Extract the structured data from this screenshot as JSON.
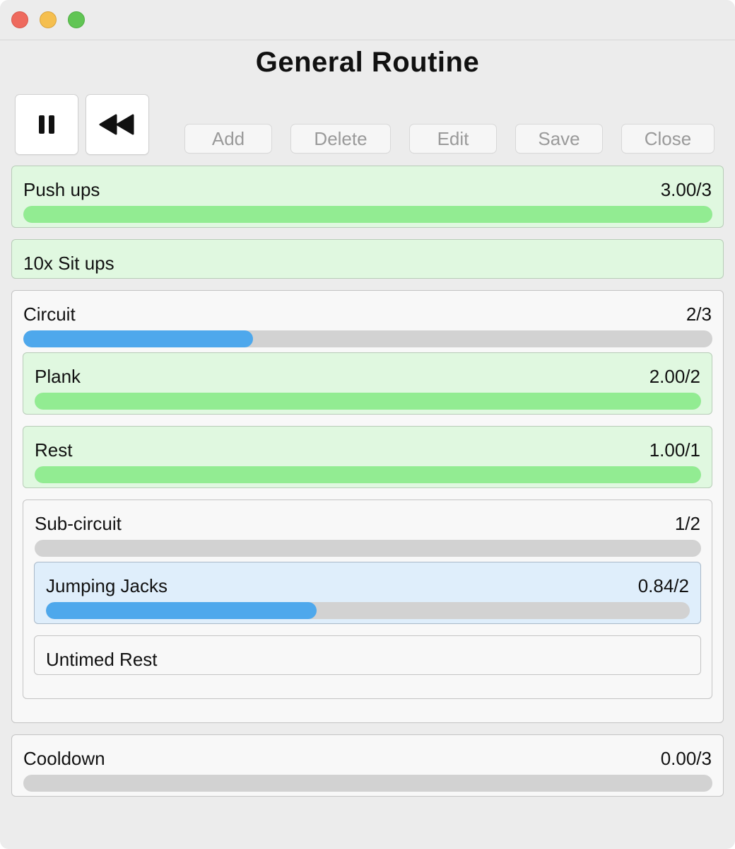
{
  "window": {
    "title": "General Routine"
  },
  "controls": {
    "pause_icon": "pause-icon",
    "rewind_icon": "rewind-icon"
  },
  "toolbar": {
    "add_label": "Add",
    "delete_label": "Delete",
    "edit_label": "Edit",
    "save_label": "Save",
    "close_label": "Close"
  },
  "colors": {
    "done_card": "#e0f8e0",
    "active_card": "#dfeefb",
    "progress_green": "#92ec92",
    "progress_blue": "#4ea8ec",
    "progress_track": "#d2d2d2"
  },
  "items": {
    "push_ups": {
      "label": "Push ups",
      "value": "3.00/3",
      "progress": 1.0
    },
    "sit_ups": {
      "label": "10x Sit ups"
    },
    "circuit": {
      "label": "Circuit",
      "value": "2/3",
      "progress": 0.333
    },
    "plank": {
      "label": "Plank",
      "value": "2.00/2",
      "progress": 1.0
    },
    "rest": {
      "label": "Rest",
      "value": "1.00/1",
      "progress": 1.0
    },
    "sub_circuit": {
      "label": "Sub-circuit",
      "value": "1/2",
      "progress": 0.0
    },
    "jumping_jacks": {
      "label": "Jumping Jacks",
      "value": "0.84/2",
      "progress": 0.42
    },
    "untimed_rest": {
      "label": "Untimed Rest"
    },
    "cooldown": {
      "label": "Cooldown",
      "value": "0.00/3",
      "progress": 0.0
    }
  }
}
